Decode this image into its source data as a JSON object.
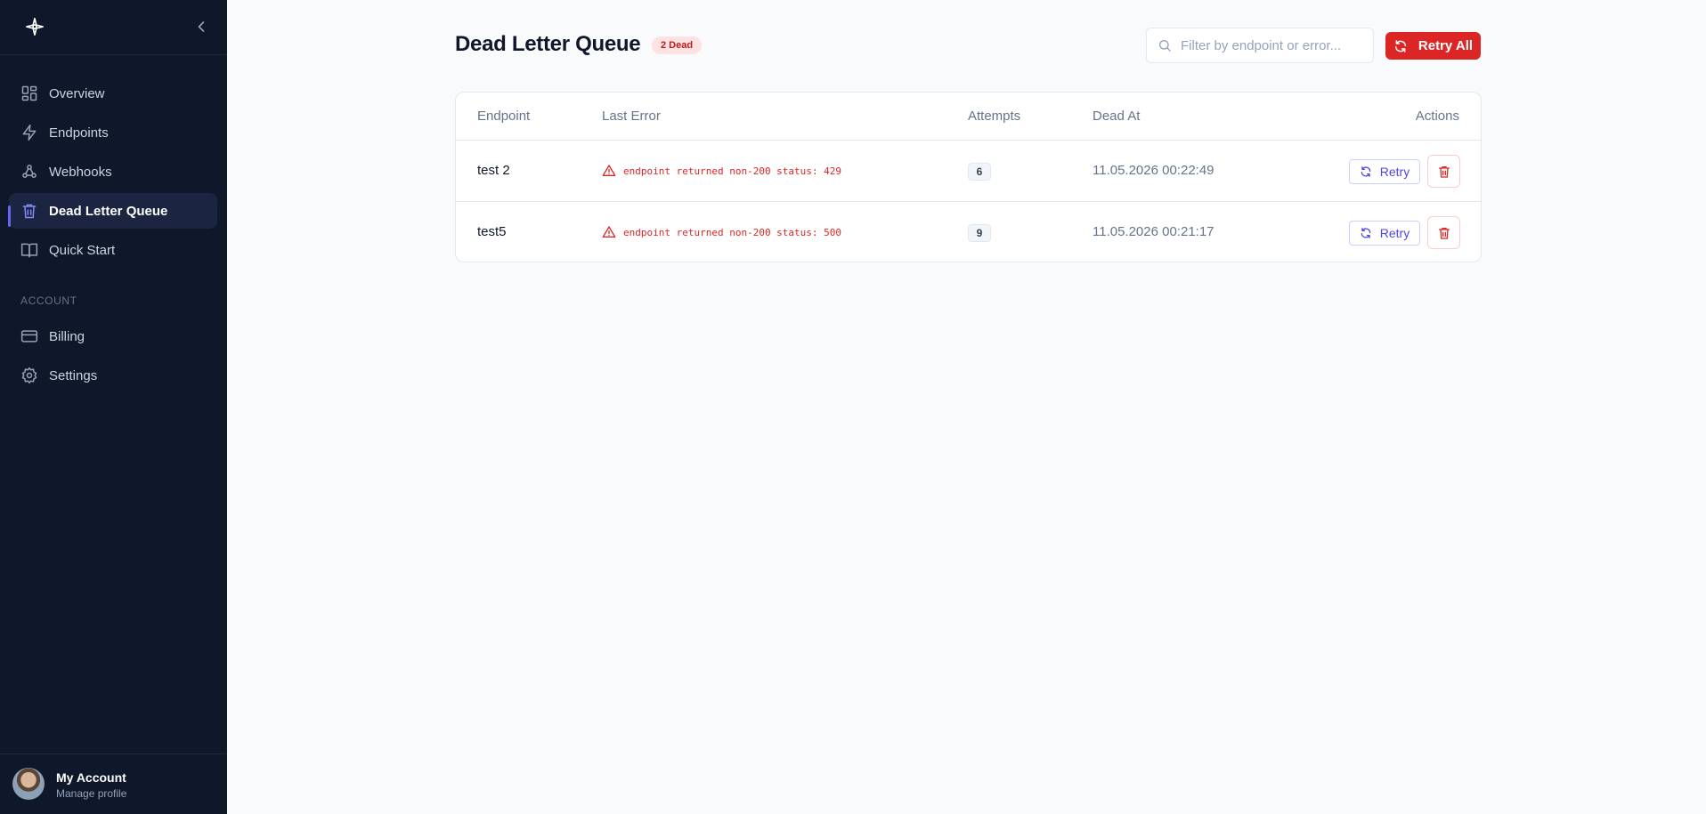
{
  "colors": {
    "sidebar_bg": "#0f172a",
    "accent": "#6366f1",
    "danger": "#dc2626",
    "page_bg": "#f8fafc"
  },
  "sidebar": {
    "logo_icon": "compass-star-icon",
    "collapse_icon": "chevron-left-icon",
    "items": [
      {
        "label": "Overview",
        "icon": "grid-icon",
        "active": false
      },
      {
        "label": "Endpoints",
        "icon": "bolt-icon",
        "active": false
      },
      {
        "label": "Webhooks",
        "icon": "webhook-icon",
        "active": false
      },
      {
        "label": "Dead Letter Queue",
        "icon": "trash-icon",
        "active": true
      },
      {
        "label": "Quick Start",
        "icon": "book-icon",
        "active": false
      }
    ],
    "account_section_label": "ACCOUNT",
    "account_items": [
      {
        "label": "Billing",
        "icon": "credit-card-icon"
      },
      {
        "label": "Settings",
        "icon": "gear-icon"
      }
    ],
    "profile": {
      "name": "My Account",
      "subtitle": "Manage profile"
    }
  },
  "header": {
    "title": "Dead Letter Queue",
    "badge": "2 Dead",
    "search_placeholder": "Filter by endpoint or error...",
    "retry_all_label": "Retry All"
  },
  "table": {
    "columns": [
      "Endpoint",
      "Last Error",
      "Attempts",
      "Dead At",
      "Actions"
    ],
    "rows": [
      {
        "endpoint": "test 2",
        "error": "endpoint returned non-200 status: 429",
        "attempts": "6",
        "dead_at": "11.05.2026 00:22:49",
        "retry_label": "Retry"
      },
      {
        "endpoint": "test5",
        "error": "endpoint returned non-200 status: 500",
        "attempts": "9",
        "dead_at": "11.05.2026 00:21:17",
        "retry_label": "Retry"
      }
    ]
  }
}
